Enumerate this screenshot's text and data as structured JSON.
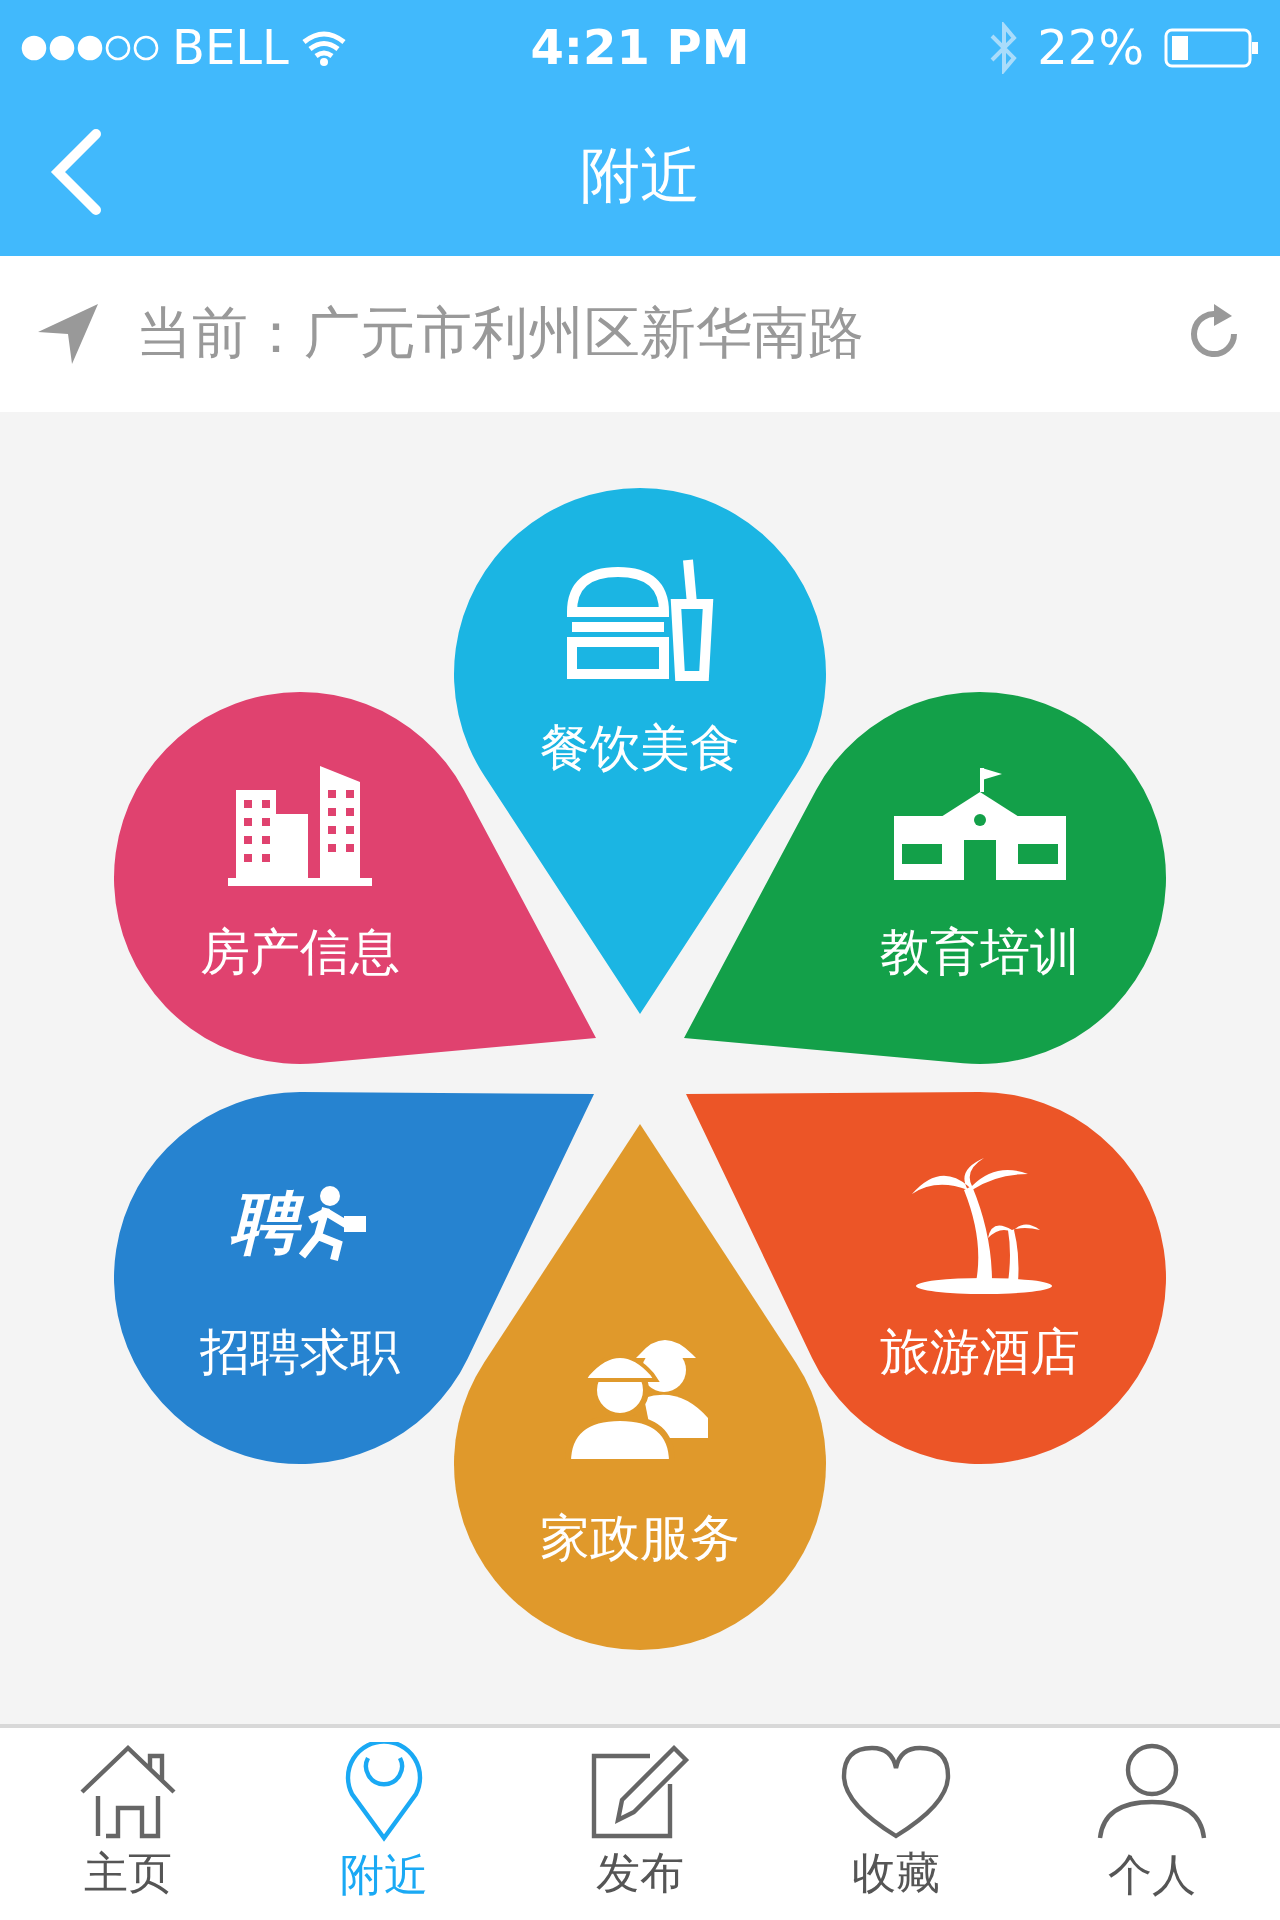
{
  "status_bar": {
    "carrier": "BELL",
    "time": "4:21 PM",
    "battery": "22%"
  },
  "nav_bar": {
    "title": "附近"
  },
  "location": {
    "text": "当前：广元市利州区新华南路"
  },
  "categories": [
    {
      "label": "餐饮美食",
      "kind": "food",
      "color": "#1bb5e3"
    },
    {
      "label": "房产信息",
      "kind": "buildings",
      "color": "#e0426f"
    },
    {
      "label": "教育培训",
      "kind": "school",
      "color": "#13a049"
    },
    {
      "label": "招聘求职",
      "kind": "recruit",
      "icon_text": "聘",
      "color": "#2683d0"
    },
    {
      "label": "旅游酒店",
      "kind": "palm",
      "color": "#ec5527"
    },
    {
      "label": "家政服务",
      "kind": "workers",
      "color": "#e0992b"
    }
  ],
  "tabs": [
    {
      "label": "主页",
      "kind": "home",
      "selected": false
    },
    {
      "label": "附近",
      "kind": "pin",
      "selected": true
    },
    {
      "label": "发布",
      "kind": "edit",
      "selected": false
    },
    {
      "label": "收藏",
      "kind": "heart",
      "selected": false
    },
    {
      "label": "个人",
      "kind": "person",
      "selected": false
    }
  ]
}
